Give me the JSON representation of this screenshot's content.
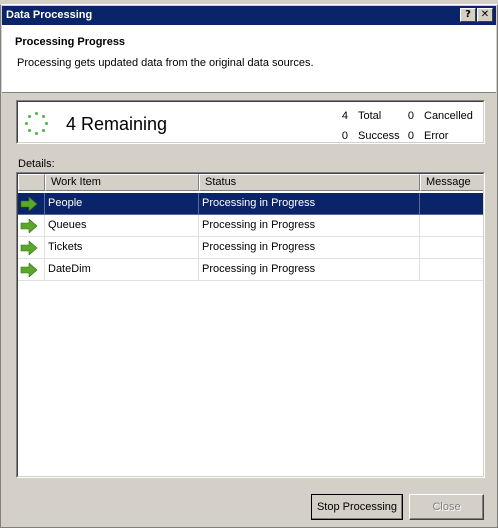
{
  "dialog": {
    "title": "Data Processing",
    "help_glyph": "?",
    "close_glyph": "✕"
  },
  "header": {
    "title": "Processing Progress",
    "description": "Processing gets updated data from the original data sources."
  },
  "progress": {
    "remaining_label": "4 Remaining",
    "total_value": "4",
    "total_label": "Total",
    "cancelled_value": "0",
    "cancelled_label": "Cancelled",
    "success_value": "0",
    "success_label": "Success",
    "error_value": "0",
    "error_label": "Error",
    "spinner_color": "#44b844"
  },
  "details": {
    "label": "Details:",
    "columns": [
      "Work Item",
      "Status",
      "Message"
    ],
    "rows": [
      {
        "icon": "green-arrow-icon",
        "work_item": "People",
        "status": "Processing in Progress",
        "message": "",
        "selected": true
      },
      {
        "icon": "green-arrow-icon",
        "work_item": "Queues",
        "status": "Processing in Progress",
        "message": "",
        "selected": false
      },
      {
        "icon": "green-arrow-icon",
        "work_item": "Tickets",
        "status": "Processing in Progress",
        "message": "",
        "selected": false
      },
      {
        "icon": "green-arrow-icon",
        "work_item": "DateDim",
        "status": "Processing in Progress",
        "message": "",
        "selected": false
      }
    ]
  },
  "buttons": {
    "stop_label": "Stop Processing",
    "close_label": "Close"
  },
  "colors": {
    "titlebar": "#0a246a",
    "selection": "#0a246a",
    "arrow": "#5aa82a"
  }
}
